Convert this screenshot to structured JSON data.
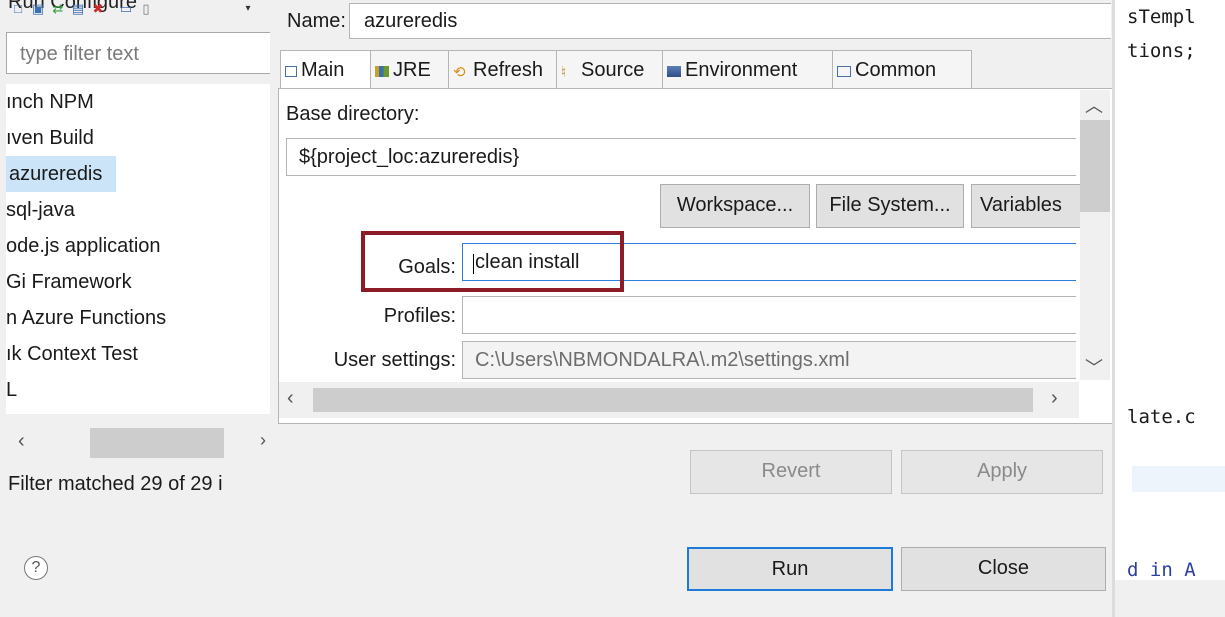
{
  "window": {
    "title_fragment": "Run Configure"
  },
  "left_panel": {
    "filter_placeholder": "type filter text",
    "items": [
      {
        "label": "ınch NPM"
      },
      {
        "label": "ıven Build"
      },
      {
        "label": "azureredis",
        "selected": true
      },
      {
        "label": "sql-java"
      },
      {
        "label": "ode.js application"
      },
      {
        "label": "Gi Framework"
      },
      {
        "label": "n Azure Functions"
      },
      {
        "label": "ık Context Test"
      },
      {
        "label": "L"
      }
    ],
    "filter_status": "Filter matched 29 of 29 i"
  },
  "dialog": {
    "name_label": "Name:",
    "name_value": "azureredis",
    "tabs": [
      {
        "label": "Main",
        "icon": "main-tab-icon",
        "active": true
      },
      {
        "label": "JRE",
        "icon": "jre-icon"
      },
      {
        "label": "Refresh",
        "icon": "refresh-icon"
      },
      {
        "label": "Source",
        "icon": "source-icon"
      },
      {
        "label": "Environment",
        "icon": "environment-icon"
      },
      {
        "label": "Common",
        "icon": "common-icon"
      }
    ],
    "base_directory_label": "Base directory:",
    "base_directory_value": "${project_loc:azureredis}",
    "workspace_button": "Workspace...",
    "file_system_button": "File System...",
    "variables_button": "Variables",
    "goals_label": "Goals:",
    "goals_value": "clean install",
    "profiles_label": "Profiles:",
    "profiles_value": "",
    "user_settings_label": "User settings:",
    "user_settings_value": "C:\\Users\\NBMONDALRA\\.m2\\settings.xml",
    "revert_button": "Revert",
    "apply_button": "Apply",
    "run_button": "Run",
    "close_button": "Close",
    "help_icon_glyph": "?",
    "highlight_color": "#8b1c28"
  },
  "editor": {
    "lines": [
      "sTempl",
      "tions;",
      "late.c",
      "d in A"
    ]
  }
}
